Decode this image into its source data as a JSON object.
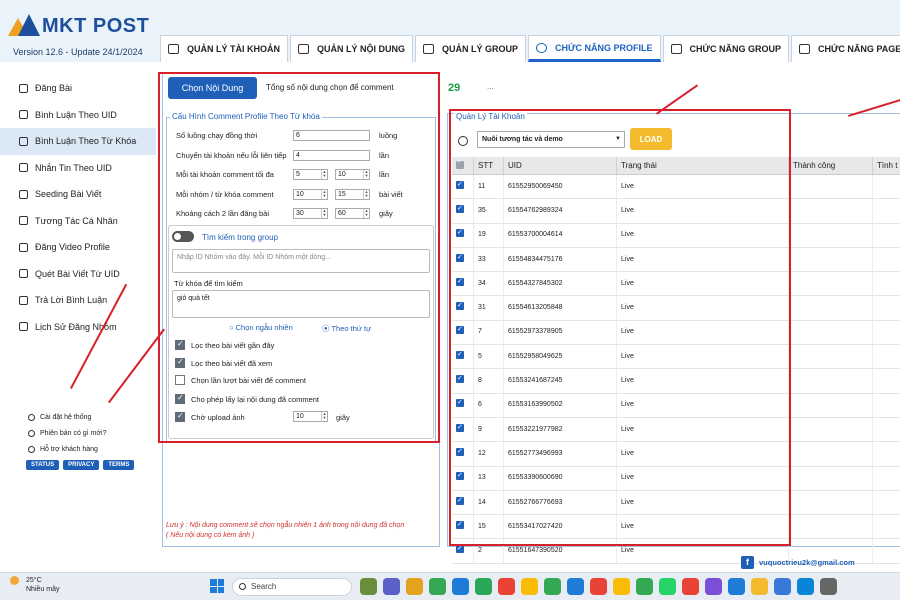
{
  "app": {
    "logo_text": "MKT POST",
    "version": "Version  12.6  - Update  24/1/2024"
  },
  "tabs": [
    {
      "label": "QUẢN LÝ TÀI KHOẢN",
      "icon": "id-card-icon"
    },
    {
      "label": "QUẢN LÝ NỘI DUNG",
      "icon": "list-icon"
    },
    {
      "label": "QUẢN LÝ GROUP",
      "icon": "window-icon"
    },
    {
      "label": "CHỨC NĂNG PROFILE",
      "icon": "wifi-icon",
      "active": true
    },
    {
      "label": "CHỨC NĂNG GROUP",
      "icon": "group-icon"
    },
    {
      "label": "CHỨC NĂNG PAGE",
      "icon": "facebook-icon"
    }
  ],
  "sidebar": {
    "items": [
      {
        "label": "Đăng Bài",
        "icon": "post-icon"
      },
      {
        "label": "Bình Luận Theo UID",
        "icon": "comment-icon"
      },
      {
        "label": "Bình Luận Theo Từ Khóa",
        "icon": "keyword-comment-icon",
        "active": true
      },
      {
        "label": "Nhắn Tin Theo UID",
        "icon": "message-icon"
      },
      {
        "label": "Seeding Bài Viết",
        "icon": "seeding-icon"
      },
      {
        "label": "Tương Tác Cá Nhân",
        "icon": "interact-icon"
      },
      {
        "label": "Đăng Video Profile",
        "icon": "video-icon"
      },
      {
        "label": "Quét Bài Viết Từ UID",
        "icon": "scan-icon"
      },
      {
        "label": "Trả Lời Bình Luận",
        "icon": "reply-icon"
      },
      {
        "label": "Lịch Sử Đăng Nhóm",
        "icon": "history-icon"
      }
    ],
    "footer": [
      "Cài đặt hệ thống",
      "Phiên bản có gì mới?",
      "Hỗ trợ khách hàng"
    ],
    "badges": [
      "STATUS",
      "PRIVACY",
      "TERMS"
    ]
  },
  "content": {
    "choose_button": "Chọn Nội Dung",
    "total_label": "Tổng số nội dung chọn để comment",
    "total_count": "29",
    "dots": "..."
  },
  "config": {
    "title": "Cấu Hình Comment Profile Theo Từ khóa",
    "rows": [
      {
        "label": "Số luồng chạy đồng thời",
        "v1": "6",
        "unit": "luồng"
      },
      {
        "label": "Chuyển tài khoản nếu lỗi liên tiếp",
        "v1": "4",
        "unit": "lần"
      },
      {
        "label": "Mỗi tài khoản comment tối đa",
        "v1": "5",
        "v2": "10",
        "unit": "lần"
      },
      {
        "label": "Mỗi nhóm / từ khóa comment",
        "v1": "10",
        "v2": "15",
        "unit": "bài viết"
      },
      {
        "label": "Khoảng cách 2 lần đăng bài",
        "v1": "30",
        "v2": "60",
        "unit": "giây"
      }
    ],
    "toggle_label": "Tìm kiếm trong group",
    "group_id_placeholder": "Nhập ID Nhóm vào đây. Mỗi ID Nhóm một dòng...",
    "keyword_label": "Từ khóa để tìm kiếm",
    "keyword_value": "giỏ quà tết",
    "radio_random": "Chọn ngẫu nhiên",
    "radio_order": "Theo thứ tự",
    "checkboxes": [
      {
        "label": "Lọc theo bài viết gần đây",
        "checked": true
      },
      {
        "label": "Lọc theo bài viết đã xem",
        "checked": true
      },
      {
        "label": "Chọn lần lượt bài viết để comment",
        "checked": false
      },
      {
        "label": "Cho phép lấy lại nội dung đã comment",
        "checked": true
      },
      {
        "label": "Chờ upload ảnh",
        "checked": true,
        "value": "10",
        "unit": "giây"
      }
    ],
    "note_line1": "Lưu ý : Nội dung comment sẽ chọn ngẫu nhiên 1 ảnh trong nội dung đã chọn",
    "note_line2": "( Nếu nội dung có kèm ảnh )"
  },
  "accounts": {
    "title": "Quản Lý Tài Khoản",
    "combo_value": "Nuôi tương  tác và demo",
    "load_button": "LOAD",
    "headers": [
      "STT",
      "UID",
      "Trạng thái",
      "Thành công",
      "Tình t"
    ],
    "rows": [
      {
        "stt": "11",
        "uid": "61552950069450",
        "status": "Live"
      },
      {
        "stt": "35",
        "uid": "61554762989324",
        "status": "Live"
      },
      {
        "stt": "19",
        "uid": "61553700004614",
        "status": "Live"
      },
      {
        "stt": "33",
        "uid": "61554834475176",
        "status": "Live"
      },
      {
        "stt": "34",
        "uid": "61554327845302",
        "status": "Live"
      },
      {
        "stt": "31",
        "uid": "61554613205848",
        "status": "Live"
      },
      {
        "stt": "7",
        "uid": "61552973378905",
        "status": "Live"
      },
      {
        "stt": "5",
        "uid": "61552958049625",
        "status": "Live"
      },
      {
        "stt": "8",
        "uid": "61553241687245",
        "status": "Live"
      },
      {
        "stt": "6",
        "uid": "61553163990502",
        "status": "Live"
      },
      {
        "stt": "9",
        "uid": "61553221977982",
        "status": "Live"
      },
      {
        "stt": "12",
        "uid": "61552773496993",
        "status": "Live"
      },
      {
        "stt": "13",
        "uid": "61553390600690",
        "status": "Live"
      },
      {
        "stt": "14",
        "uid": "61552766776693",
        "status": "Live"
      },
      {
        "stt": "15",
        "uid": "61553417027420",
        "status": "Live"
      },
      {
        "stt": "2",
        "uid": "61551647390520",
        "status": "Live"
      }
    ]
  },
  "contact_email": "vuquoctrieu2k@gmail.com",
  "taskbar": {
    "temp": "25°C",
    "weather": "Nhiều mây",
    "search_placeholder": "Search"
  },
  "colors": {
    "accent": "#1e5fb8",
    "annotation_red": "#d8202a",
    "count_green": "#1a9a45",
    "load_yellow": "#f3bb2d"
  }
}
